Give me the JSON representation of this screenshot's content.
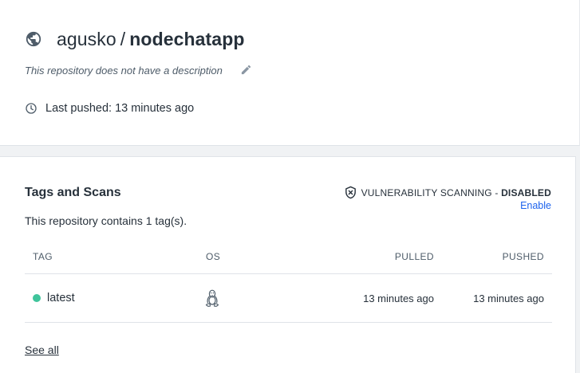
{
  "repo": {
    "namespace": "agusko",
    "separator": "/",
    "name": "nodechatapp",
    "description": "This repository does not have a description",
    "last_pushed": "Last pushed: 13 minutes ago",
    "icons": {
      "visibility": "globe-icon",
      "edit": "pencil-icon",
      "time": "clock-icon"
    }
  },
  "tags": {
    "title": "Tags and Scans",
    "count_text": "This repository contains 1 tag(s).",
    "vulnerability": {
      "label": "VULNERABILITY SCANNING - ",
      "state": "DISABLED",
      "action": "Enable",
      "icon": "shield-x-icon"
    },
    "columns": {
      "tag": "TAG",
      "os": "OS",
      "pulled": "PULLED",
      "pushed": "PUSHED"
    },
    "rows": [
      {
        "tag": "latest",
        "os_icon": "linux-tux-icon",
        "pulled": "13 minutes ago",
        "pushed": "13 minutes ago",
        "status_color": "#3fc49b"
      }
    ],
    "see_all": "See all"
  },
  "colors": {
    "link": "#1d63ed",
    "text": "#27313b",
    "muted": "#4e5c69",
    "background": "#f0f2f4"
  }
}
